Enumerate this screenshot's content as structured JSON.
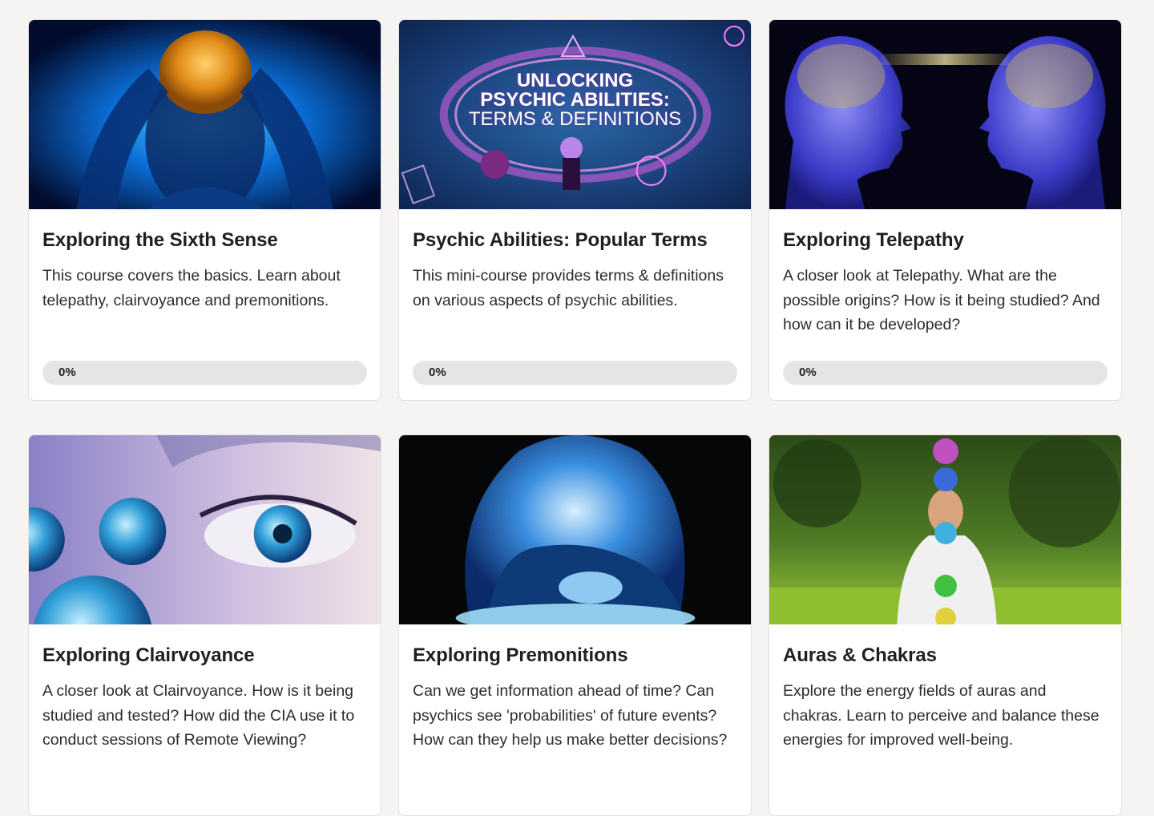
{
  "courses": [
    {
      "title": "Exploring the Sixth Sense",
      "description": "This course covers the basics. Learn about telepathy, clairvoyance and premonitions.",
      "progress": 0,
      "progress_label": "0%",
      "image_icon": "sixth-sense-brain-image"
    },
    {
      "title": "Psychic Abilities: Popular Terms",
      "description": "This mini-course provides terms & definitions on various aspects of psychic abilities.",
      "progress": 0,
      "progress_label": "0%",
      "image_icon": "psychic-terms-image",
      "image_text": [
        "UNLOCKING",
        "PSYCHIC ABILITIES:",
        "TERMS & DEFINITIONS"
      ]
    },
    {
      "title": "Exploring Telepathy",
      "description": "A closer look at Telepathy. What are the possible origins? How is it being studied? And how can it be developed?",
      "progress": 0,
      "progress_label": "0%",
      "image_icon": "telepathy-heads-image"
    },
    {
      "title": "Exploring Clairvoyance",
      "description": "A closer look at Clairvoyance. How is it being studied and tested? How did the CIA use it to conduct sessions of Remote Viewing?",
      "image_icon": "clairvoyance-eye-image"
    },
    {
      "title": "Exploring Premonitions",
      "description": "Can we get information ahead of time? Can psychics see 'probabilities' of future events? How can they help us make better decisions?",
      "image_icon": "premonitions-dream-image"
    },
    {
      "title": "Auras & Chakras",
      "description": "Explore the energy fields of auras and chakras. Learn to perceive and balance these energies for improved well-being.",
      "image_icon": "auras-chakras-meditation-image"
    }
  ]
}
